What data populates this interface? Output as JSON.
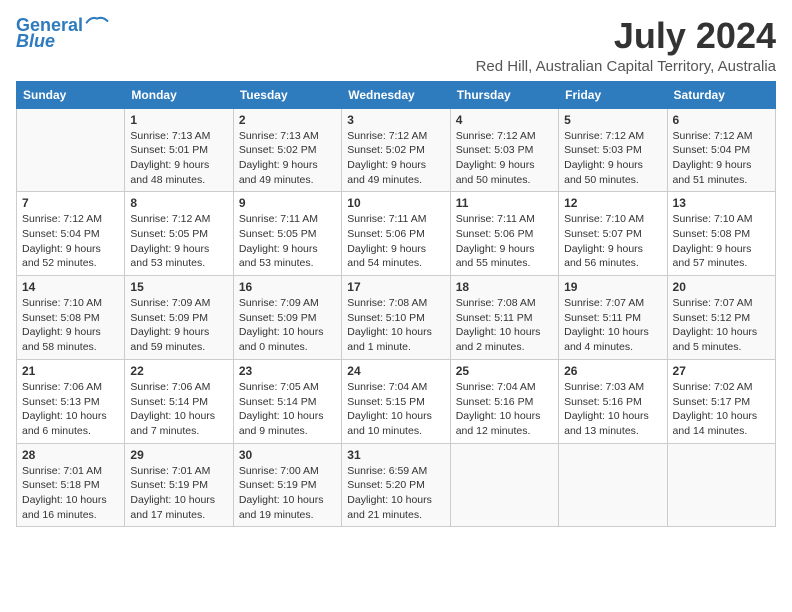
{
  "header": {
    "logo_line1": "General",
    "logo_line2": "Blue",
    "month": "July 2024",
    "location": "Red Hill, Australian Capital Territory, Australia"
  },
  "weekdays": [
    "Sunday",
    "Monday",
    "Tuesday",
    "Wednesday",
    "Thursday",
    "Friday",
    "Saturday"
  ],
  "weeks": [
    [
      {
        "day": "",
        "info": ""
      },
      {
        "day": "1",
        "info": "Sunrise: 7:13 AM\nSunset: 5:01 PM\nDaylight: 9 hours\nand 48 minutes."
      },
      {
        "day": "2",
        "info": "Sunrise: 7:13 AM\nSunset: 5:02 PM\nDaylight: 9 hours\nand 49 minutes."
      },
      {
        "day": "3",
        "info": "Sunrise: 7:12 AM\nSunset: 5:02 PM\nDaylight: 9 hours\nand 49 minutes."
      },
      {
        "day": "4",
        "info": "Sunrise: 7:12 AM\nSunset: 5:03 PM\nDaylight: 9 hours\nand 50 minutes."
      },
      {
        "day": "5",
        "info": "Sunrise: 7:12 AM\nSunset: 5:03 PM\nDaylight: 9 hours\nand 50 minutes."
      },
      {
        "day": "6",
        "info": "Sunrise: 7:12 AM\nSunset: 5:04 PM\nDaylight: 9 hours\nand 51 minutes."
      }
    ],
    [
      {
        "day": "7",
        "info": "Sunrise: 7:12 AM\nSunset: 5:04 PM\nDaylight: 9 hours\nand 52 minutes."
      },
      {
        "day": "8",
        "info": "Sunrise: 7:12 AM\nSunset: 5:05 PM\nDaylight: 9 hours\nand 53 minutes."
      },
      {
        "day": "9",
        "info": "Sunrise: 7:11 AM\nSunset: 5:05 PM\nDaylight: 9 hours\nand 53 minutes."
      },
      {
        "day": "10",
        "info": "Sunrise: 7:11 AM\nSunset: 5:06 PM\nDaylight: 9 hours\nand 54 minutes."
      },
      {
        "day": "11",
        "info": "Sunrise: 7:11 AM\nSunset: 5:06 PM\nDaylight: 9 hours\nand 55 minutes."
      },
      {
        "day": "12",
        "info": "Sunrise: 7:10 AM\nSunset: 5:07 PM\nDaylight: 9 hours\nand 56 minutes."
      },
      {
        "day": "13",
        "info": "Sunrise: 7:10 AM\nSunset: 5:08 PM\nDaylight: 9 hours\nand 57 minutes."
      }
    ],
    [
      {
        "day": "14",
        "info": "Sunrise: 7:10 AM\nSunset: 5:08 PM\nDaylight: 9 hours\nand 58 minutes."
      },
      {
        "day": "15",
        "info": "Sunrise: 7:09 AM\nSunset: 5:09 PM\nDaylight: 9 hours\nand 59 minutes."
      },
      {
        "day": "16",
        "info": "Sunrise: 7:09 AM\nSunset: 5:09 PM\nDaylight: 10 hours\nand 0 minutes."
      },
      {
        "day": "17",
        "info": "Sunrise: 7:08 AM\nSunset: 5:10 PM\nDaylight: 10 hours\nand 1 minute."
      },
      {
        "day": "18",
        "info": "Sunrise: 7:08 AM\nSunset: 5:11 PM\nDaylight: 10 hours\nand 2 minutes."
      },
      {
        "day": "19",
        "info": "Sunrise: 7:07 AM\nSunset: 5:11 PM\nDaylight: 10 hours\nand 4 minutes."
      },
      {
        "day": "20",
        "info": "Sunrise: 7:07 AM\nSunset: 5:12 PM\nDaylight: 10 hours\nand 5 minutes."
      }
    ],
    [
      {
        "day": "21",
        "info": "Sunrise: 7:06 AM\nSunset: 5:13 PM\nDaylight: 10 hours\nand 6 minutes."
      },
      {
        "day": "22",
        "info": "Sunrise: 7:06 AM\nSunset: 5:14 PM\nDaylight: 10 hours\nand 7 minutes."
      },
      {
        "day": "23",
        "info": "Sunrise: 7:05 AM\nSunset: 5:14 PM\nDaylight: 10 hours\nand 9 minutes."
      },
      {
        "day": "24",
        "info": "Sunrise: 7:04 AM\nSunset: 5:15 PM\nDaylight: 10 hours\nand 10 minutes."
      },
      {
        "day": "25",
        "info": "Sunrise: 7:04 AM\nSunset: 5:16 PM\nDaylight: 10 hours\nand 12 minutes."
      },
      {
        "day": "26",
        "info": "Sunrise: 7:03 AM\nSunset: 5:16 PM\nDaylight: 10 hours\nand 13 minutes."
      },
      {
        "day": "27",
        "info": "Sunrise: 7:02 AM\nSunset: 5:17 PM\nDaylight: 10 hours\nand 14 minutes."
      }
    ],
    [
      {
        "day": "28",
        "info": "Sunrise: 7:01 AM\nSunset: 5:18 PM\nDaylight: 10 hours\nand 16 minutes."
      },
      {
        "day": "29",
        "info": "Sunrise: 7:01 AM\nSunset: 5:19 PM\nDaylight: 10 hours\nand 17 minutes."
      },
      {
        "day": "30",
        "info": "Sunrise: 7:00 AM\nSunset: 5:19 PM\nDaylight: 10 hours\nand 19 minutes."
      },
      {
        "day": "31",
        "info": "Sunrise: 6:59 AM\nSunset: 5:20 PM\nDaylight: 10 hours\nand 21 minutes."
      },
      {
        "day": "",
        "info": ""
      },
      {
        "day": "",
        "info": ""
      },
      {
        "day": "",
        "info": ""
      }
    ]
  ]
}
